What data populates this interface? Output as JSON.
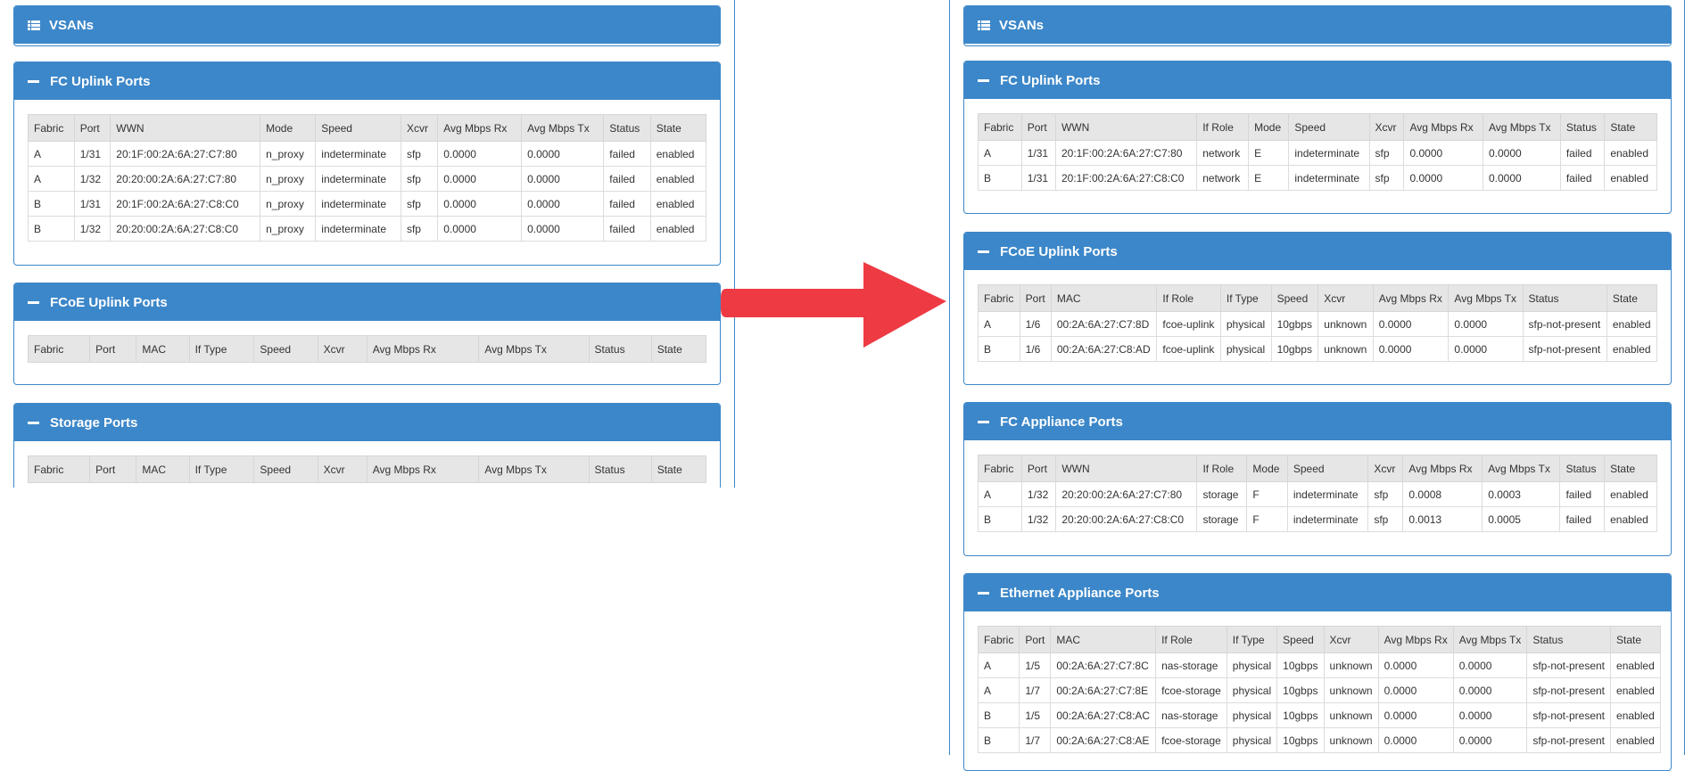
{
  "left": {
    "vsans": {
      "title": "VSANs"
    },
    "fc_uplink": {
      "title": "FC Uplink Ports",
      "columns": [
        "Fabric",
        "Port",
        "WWN",
        "Mode",
        "Speed",
        "Xcvr",
        "Avg Mbps Rx",
        "Avg Mbps Tx",
        "Status",
        "State"
      ],
      "rows": [
        [
          "A",
          "1/31",
          "20:1F:00:2A:6A:27:C7:80",
          "n_proxy",
          "indeterminate",
          "sfp",
          "0.0000",
          "0.0000",
          "failed",
          "enabled"
        ],
        [
          "A",
          "1/32",
          "20:20:00:2A:6A:27:C7:80",
          "n_proxy",
          "indeterminate",
          "sfp",
          "0.0000",
          "0.0000",
          "failed",
          "enabled"
        ],
        [
          "B",
          "1/31",
          "20:1F:00:2A:6A:27:C8:C0",
          "n_proxy",
          "indeterminate",
          "sfp",
          "0.0000",
          "0.0000",
          "failed",
          "enabled"
        ],
        [
          "B",
          "1/32",
          "20:20:00:2A:6A:27:C8:C0",
          "n_proxy",
          "indeterminate",
          "sfp",
          "0.0000",
          "0.0000",
          "failed",
          "enabled"
        ]
      ]
    },
    "fcoe_uplink": {
      "title": "FCoE Uplink Ports",
      "columns": [
        "Fabric",
        "Port",
        "MAC",
        "If Type",
        "Speed",
        "Xcvr",
        "Avg Mbps Rx",
        "Avg Mbps Tx",
        "Status",
        "State"
      ],
      "rows": []
    },
    "storage": {
      "title": "Storage Ports",
      "columns": [
        "Fabric",
        "Port",
        "MAC",
        "If Type",
        "Speed",
        "Xcvr",
        "Avg Mbps Rx",
        "Avg Mbps Tx",
        "Status",
        "State"
      ],
      "rows": []
    }
  },
  "right": {
    "vsans": {
      "title": "VSANs"
    },
    "fc_uplink": {
      "title": "FC Uplink Ports",
      "columns": [
        "Fabric",
        "Port",
        "WWN",
        "If Role",
        "Mode",
        "Speed",
        "Xcvr",
        "Avg Mbps Rx",
        "Avg Mbps Tx",
        "Status",
        "State"
      ],
      "rows": [
        [
          "A",
          "1/31",
          "20:1F:00:2A:6A:27:C7:80",
          "network",
          "E",
          "indeterminate",
          "sfp",
          "0.0000",
          "0.0000",
          "failed",
          "enabled"
        ],
        [
          "B",
          "1/31",
          "20:1F:00:2A:6A:27:C8:C0",
          "network",
          "E",
          "indeterminate",
          "sfp",
          "0.0000",
          "0.0000",
          "failed",
          "enabled"
        ]
      ]
    },
    "fcoe_uplink": {
      "title": "FCoE Uplink Ports",
      "columns": [
        "Fabric",
        "Port",
        "MAC",
        "If Role",
        "If Type",
        "Speed",
        "Xcvr",
        "Avg Mbps Rx",
        "Avg Mbps Tx",
        "Status",
        "State"
      ],
      "rows": [
        [
          "A",
          "1/6",
          "00:2A:6A:27:C7:8D",
          "fcoe-uplink",
          "physical",
          "10gbps",
          "unknown",
          "0.0000",
          "0.0000",
          "sfp-not-present",
          "enabled"
        ],
        [
          "B",
          "1/6",
          "00:2A:6A:27:C8:AD",
          "fcoe-uplink",
          "physical",
          "10gbps",
          "unknown",
          "0.0000",
          "0.0000",
          "sfp-not-present",
          "enabled"
        ]
      ]
    },
    "fc_appliance": {
      "title": "FC Appliance Ports",
      "columns": [
        "Fabric",
        "Port",
        "WWN",
        "If Role",
        "Mode",
        "Speed",
        "Xcvr",
        "Avg Mbps Rx",
        "Avg Mbps Tx",
        "Status",
        "State"
      ],
      "rows": [
        [
          "A",
          "1/32",
          "20:20:00:2A:6A:27:C7:80",
          "storage",
          "F",
          "indeterminate",
          "sfp",
          "0.0008",
          "0.0003",
          "failed",
          "enabled"
        ],
        [
          "B",
          "1/32",
          "20:20:00:2A:6A:27:C8:C0",
          "storage",
          "F",
          "indeterminate",
          "sfp",
          "0.0013",
          "0.0005",
          "failed",
          "enabled"
        ]
      ]
    },
    "eth_appliance": {
      "title": "Ethernet Appliance Ports",
      "columns": [
        "Fabric",
        "Port",
        "MAC",
        "If Role",
        "If Type",
        "Speed",
        "Xcvr",
        "Avg Mbps Rx",
        "Avg Mbps Tx",
        "Status",
        "State"
      ],
      "rows": [
        [
          "A",
          "1/5",
          "00:2A:6A:27:C7:8C",
          "nas-storage",
          "physical",
          "10gbps",
          "unknown",
          "0.0000",
          "0.0000",
          "sfp-not-present",
          "enabled"
        ],
        [
          "A",
          "1/7",
          "00:2A:6A:27:C7:8E",
          "fcoe-storage",
          "physical",
          "10gbps",
          "unknown",
          "0.0000",
          "0.0000",
          "sfp-not-present",
          "enabled"
        ],
        [
          "B",
          "1/5",
          "00:2A:6A:27:C8:AC",
          "nas-storage",
          "physical",
          "10gbps",
          "unknown",
          "0.0000",
          "0.0000",
          "sfp-not-present",
          "enabled"
        ],
        [
          "B",
          "1/7",
          "00:2A:6A:27:C8:AE",
          "fcoe-storage",
          "physical",
          "10gbps",
          "unknown",
          "0.0000",
          "0.0000",
          "sfp-not-present",
          "enabled"
        ]
      ]
    }
  },
  "colors": {
    "panel_header": "#3c87c9",
    "arrow": "#ee3a43"
  }
}
